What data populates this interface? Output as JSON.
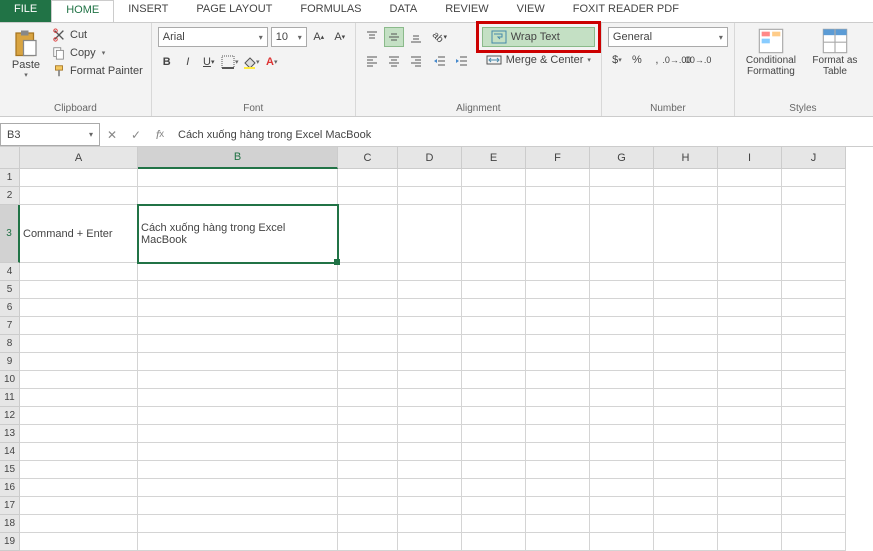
{
  "tabs": {
    "file": "FILE",
    "home": "HOME",
    "insert": "INSERT",
    "pagelayout": "PAGE LAYOUT",
    "formulas": "FORMULAS",
    "data": "DATA",
    "review": "REVIEW",
    "view": "VIEW",
    "foxit": "FOXIT READER PDF"
  },
  "clipboard": {
    "paste": "Paste",
    "cut": "Cut",
    "copy": "Copy",
    "painter": "Format Painter",
    "title": "Clipboard"
  },
  "font": {
    "name": "Arial",
    "size": "10",
    "title": "Font"
  },
  "alignment": {
    "wrap": "Wrap Text",
    "merge": "Merge & Center",
    "title": "Alignment"
  },
  "number": {
    "format": "General",
    "title": "Number"
  },
  "styles": {
    "cond": "Conditional Formatting",
    "fmt": "Format as Table",
    "title": "Styles"
  },
  "namebox": "B3",
  "formula": "Cách xuống hàng trong Excel MacBook",
  "cols": [
    "A",
    "B",
    "C",
    "D",
    "E",
    "F",
    "G",
    "H",
    "I",
    "J"
  ],
  "cells": {
    "A3": "Command + Enter",
    "B3": "Cách xuống hàng trong Excel MacBook"
  }
}
